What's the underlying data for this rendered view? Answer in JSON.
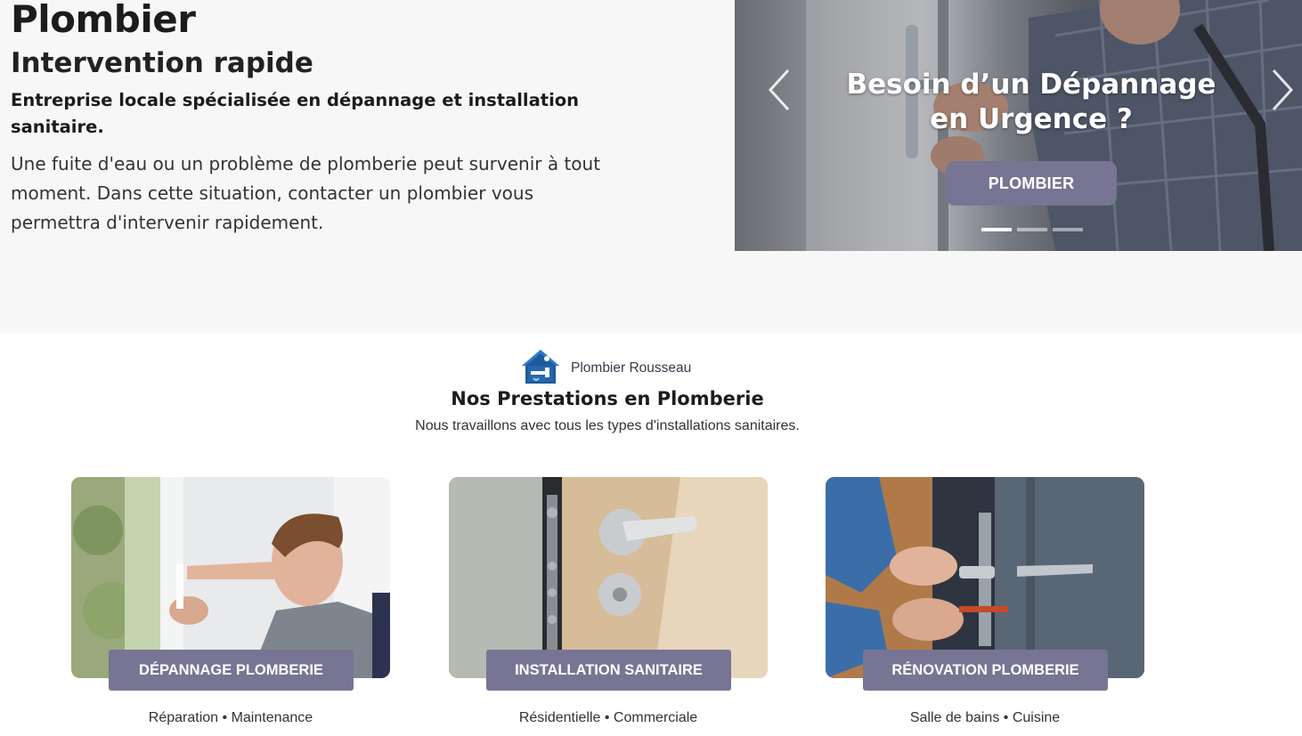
{
  "hero": {
    "title": "Plombier",
    "subtitle": "Intervention rapide",
    "lead": "Entreprise locale spécialisée en dépannage et installation sanitaire.",
    "body": "Une fuite d'eau ou un problème de plomberie peut survenir à tout moment. Dans cette situation, contacter un plombier vous permettra d'intervenir rapidement."
  },
  "slider": {
    "headline": "Besoin d’un Dépannage en Urgence ?",
    "button_label": "PLOMBIER",
    "slide_count": 3,
    "active_slide": 1,
    "prev_icon": "chevron-left-icon",
    "next_icon": "chevron-right-icon"
  },
  "section": {
    "brand_name": "Plombier Rousseau",
    "title": "Nos Prestations en Plomberie",
    "subtitle": "Nous travaillons avec tous les types d'installations sanitaires."
  },
  "cards": [
    {
      "label": "DÉPANNAGE PLOMBERIE",
      "tags": "Réparation • Maintenance"
    },
    {
      "label": "INSTALLATION SANITAIRE",
      "tags": "Résidentielle • Commerciale"
    },
    {
      "label": "RÉNOVATION PLOMBERIE",
      "tags": "Salle de bains • Cuisine"
    }
  ],
  "colors": {
    "hero_bg": "#f7f7f7",
    "accent": "#777593",
    "text": "#1c1c1c"
  }
}
